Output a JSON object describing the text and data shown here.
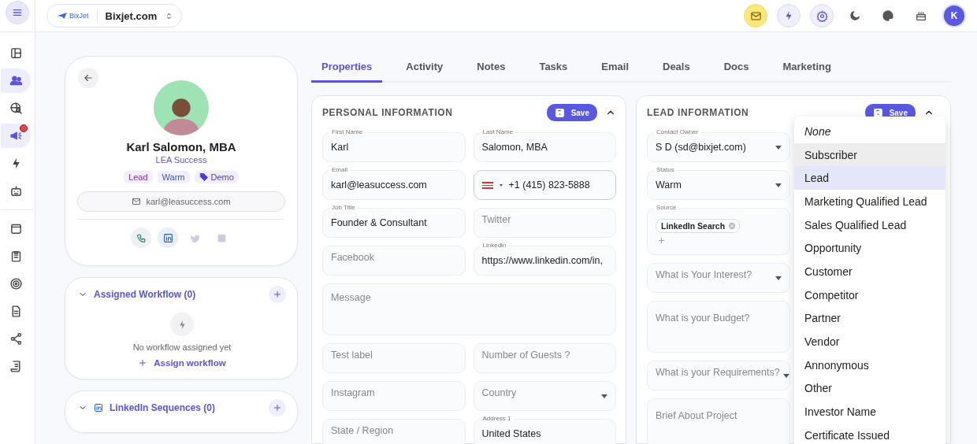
{
  "sidebar": {
    "items": [
      {
        "selected": false,
        "badge": false
      },
      {
        "selected": true,
        "badge": false
      },
      {
        "selected": false,
        "badge": false
      },
      {
        "selected": true,
        "badge": true
      },
      {
        "selected": false,
        "badge": false
      },
      {
        "selected": false,
        "badge": false
      },
      {
        "selected": false,
        "badge": false
      },
      {
        "selected": false,
        "badge": false
      },
      {
        "selected": false,
        "badge": false
      },
      {
        "selected": false,
        "badge": false
      },
      {
        "selected": false,
        "badge": false
      },
      {
        "selected": false,
        "badge": false
      }
    ]
  },
  "workspace": {
    "logo_text": "BixJet",
    "name": "Bixjet.com"
  },
  "topbar": {
    "avatar_initial": "K"
  },
  "profile": {
    "name": "Karl Salomon, MBA",
    "company": "LEA Success",
    "tags": [
      {
        "label": "Lead",
        "kind": "plain",
        "color": "#7b2fa8"
      },
      {
        "label": "Warm",
        "kind": "plain",
        "color": "#2f5bb8"
      },
      {
        "label": "Demo",
        "kind": "tagged",
        "color": "#4b3fd0"
      }
    ],
    "email": "karl@leasuccess.com",
    "socials": [
      {
        "active": true
      },
      {
        "active": true
      },
      {
        "active": false
      },
      {
        "active": false
      }
    ]
  },
  "workflow": {
    "title": "Assigned Workflow (0)",
    "empty_text": "No workflow assigned yet",
    "action": "Assign workflow"
  },
  "linkedin_sequences": {
    "title": "LinkedIn Sequences (0)"
  },
  "tabs": [
    {
      "label": "Properties",
      "selected": true
    },
    {
      "label": "Activity",
      "selected": false
    },
    {
      "label": "Notes",
      "selected": false
    },
    {
      "label": "Tasks",
      "selected": false
    },
    {
      "label": "Email",
      "selected": false
    },
    {
      "label": "Deals",
      "selected": false
    },
    {
      "label": "Docs",
      "selected": false
    },
    {
      "label": "Marketing",
      "selected": false
    }
  ],
  "personal": {
    "title": "PERSONAL INFORMATION",
    "save": "Save",
    "fields": [
      {
        "kind": "text",
        "label": "First Name",
        "value": "Karl"
      },
      {
        "kind": "text",
        "label": "Last Name",
        "value": "Salomon, MBA"
      },
      {
        "kind": "text",
        "label": "Email",
        "value": "karl@leasuccess.com"
      },
      {
        "kind": "phone",
        "value": "+1 (415) 823-5888"
      },
      {
        "kind": "text",
        "label": "Job Title",
        "value": "Founder & Consultant"
      },
      {
        "kind": "text",
        "placeholder": "Twitter"
      },
      {
        "kind": "text",
        "placeholder": "Facebook"
      },
      {
        "kind": "text",
        "label": "Linkedin",
        "value": "https://www.linkedin.com/in,"
      },
      {
        "kind": "textarea",
        "placeholder": "Message"
      },
      {
        "kind": "text",
        "placeholder": "Test label"
      },
      {
        "kind": "text",
        "placeholder": "Number of Guests ?"
      },
      {
        "kind": "text",
        "placeholder": "Instagram"
      },
      {
        "kind": "select",
        "placeholder": "Country"
      },
      {
        "kind": "text",
        "placeholder": "State / Region"
      },
      {
        "kind": "text",
        "label": "Address 1",
        "value": "United States"
      }
    ]
  },
  "lead": {
    "title": "LEAD INFORMATION",
    "save": "Save",
    "fields": [
      {
        "kind": "select",
        "label": "Contact Owner",
        "value": "S D (sd@bixjet.com)"
      },
      {
        "kind": "select",
        "label": "Status",
        "value": "Warm"
      },
      {
        "kind": "chips",
        "label": "Source",
        "chips": [
          "LinkedIn Search"
        ]
      },
      {
        "kind": "select",
        "placeholder": "What is Your Interest?"
      },
      {
        "kind": "textarea",
        "placeholder": "What is your Budget?"
      },
      {
        "kind": "select",
        "placeholder": "What is your Requirements?"
      },
      {
        "kind": "textarea",
        "placeholder": "Brief About Project"
      }
    ],
    "dropdown": [
      {
        "label": "None",
        "kind": "none",
        "selected": false,
        "hovered": false
      },
      {
        "label": "Subscriber",
        "kind": "option",
        "selected": false,
        "hovered": true
      },
      {
        "label": "Lead",
        "kind": "option",
        "selected": true,
        "hovered": false
      },
      {
        "label": "Marketing Qualified Lead",
        "kind": "option",
        "selected": false,
        "hovered": false
      },
      {
        "label": "Sales Qualified Lead",
        "kind": "option",
        "selected": false,
        "hovered": false
      },
      {
        "label": "Opportunity",
        "kind": "option",
        "selected": false,
        "hovered": false
      },
      {
        "label": "Customer",
        "kind": "option",
        "selected": false,
        "hovered": false
      },
      {
        "label": "Competitor",
        "kind": "option",
        "selected": false,
        "hovered": false
      },
      {
        "label": "Partner",
        "kind": "option",
        "selected": false,
        "hovered": false
      },
      {
        "label": "Vendor",
        "kind": "option",
        "selected": false,
        "hovered": false
      },
      {
        "label": "Annonymous",
        "kind": "option",
        "selected": false,
        "hovered": false
      },
      {
        "label": "Other",
        "kind": "option",
        "selected": false,
        "hovered": false
      },
      {
        "label": "Investor Name",
        "kind": "option",
        "selected": false,
        "hovered": false
      },
      {
        "label": "Certificate Issued",
        "kind": "option",
        "selected": false,
        "hovered": false
      }
    ]
  }
}
